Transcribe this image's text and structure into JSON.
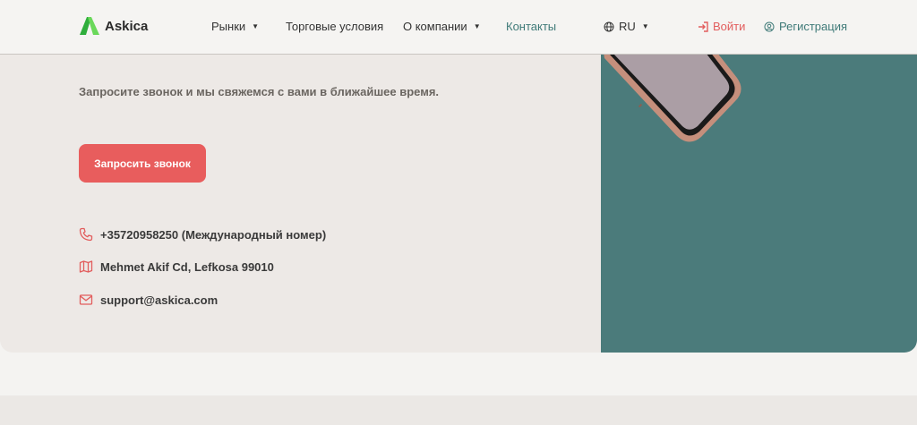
{
  "header": {
    "logo_text": "Askica",
    "nav": {
      "markets": "Рынки",
      "trading_conditions": "Торговые условия",
      "about": "О компании",
      "contacts": "Контакты",
      "language": "RU",
      "login": "Войти",
      "register": "Регистрация"
    }
  },
  "main": {
    "intro": "Запросите звонок и мы свяжемся с вами в ближайшее время.",
    "cta_label": "Запросить звонок",
    "contacts": {
      "phone": "+35720958250 (Международный номер)",
      "address": "Mehmet Akif Cd, Lefkosa 99010",
      "email": "support@askica.com"
    }
  },
  "icons": {
    "logo": "askica-logo-icon",
    "globe": "globe-icon",
    "login": "login-icon",
    "register": "user-circle-icon",
    "phone": "phone-icon",
    "map": "map-icon",
    "mail": "mail-icon"
  },
  "colors": {
    "accent": "#e85d5d",
    "teal": "#4b7b7b",
    "card_bg": "#ede9e6",
    "page_bg": "#f4f3f1",
    "logo_green": "#3cc24a"
  }
}
